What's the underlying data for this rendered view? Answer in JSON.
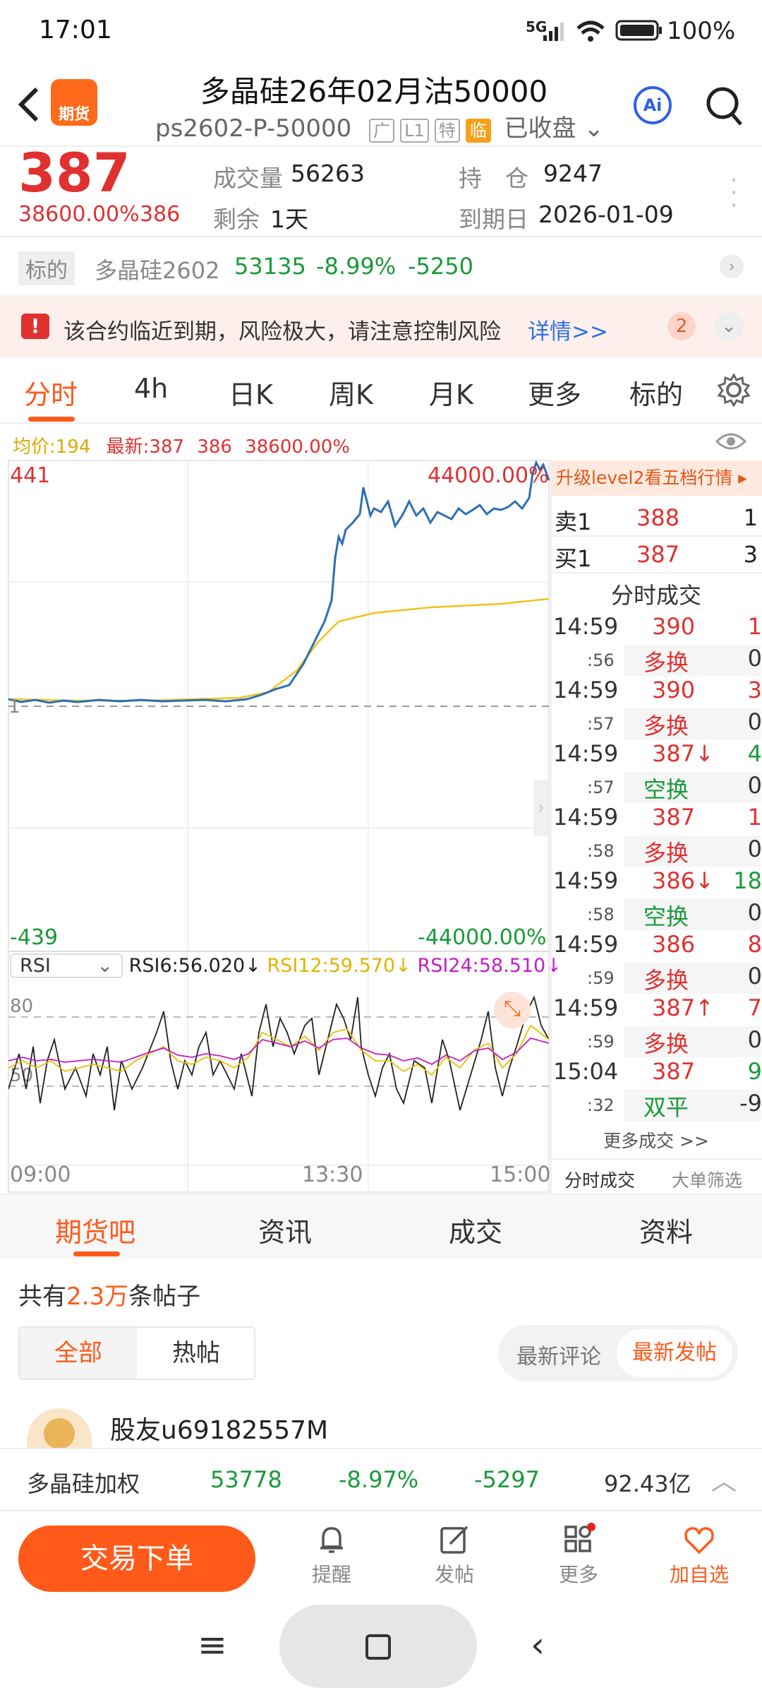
{
  "status": {
    "time": "17:01",
    "network": "5G",
    "battery": "100%"
  },
  "header": {
    "title": "多晶硅26年02月沽50000",
    "code": "ps2602-P-50000",
    "tags": [
      "广",
      "L1",
      "特",
      "临"
    ],
    "state": "已收盘",
    "app_badge": "期货",
    "ai_label": "Ai"
  },
  "quote": {
    "price": "387",
    "pct": "38600.00%",
    "change": "386",
    "vol_label": "成交量",
    "vol": "56263",
    "oi_label": "持　仓",
    "oi": "9247",
    "left_label": "剩余",
    "left": "1天",
    "exp_label": "到期日",
    "exp": "2026-01-09"
  },
  "underlying": {
    "label": "标的",
    "name": "多晶硅2602",
    "price": "53135",
    "pct": "-8.99%",
    "change": "-5250"
  },
  "warning": {
    "text": "该合约临近到期，风险极大，请注意控制风险",
    "link": "详情>>",
    "count": "2"
  },
  "tabs": [
    "分时",
    "4h",
    "日K",
    "周K",
    "月K",
    "更多",
    "标的"
  ],
  "chart_info": {
    "avg": "均价:194",
    "latest": "最新:387",
    "change": "386",
    "pct": "38600.00%"
  },
  "chart_labels": {
    "ymax": "441",
    "ymax_pct": "44000.00%",
    "ymid": "1",
    "ymin": "-439",
    "ymin_pct": "-44000.00%",
    "x": [
      "09:00",
      "13:30",
      "15:00"
    ]
  },
  "rsi": {
    "select": "RSI",
    "v6": "RSI6:56.020↓",
    "v12": "RSI12:59.570↓",
    "v24": "RSI24:58.510↓",
    "y80": "80",
    "y50": "50"
  },
  "orderbook": {
    "promo": "升级level2看五档行情 ▸",
    "sell_label": "卖1",
    "sell_price": "388",
    "sell_qty": "1",
    "buy_label": "买1",
    "buy_price": "387",
    "buy_qty": "3",
    "title": "分时成交"
  },
  "trades": [
    {
      "t": "14:59",
      "s": ":56",
      "p": "390",
      "q": "1",
      "type": "多换",
      "d": "0",
      "pc": "red",
      "tc": "red",
      "qc": "red"
    },
    {
      "t": "14:59",
      "s": ":57",
      "p": "390",
      "q": "3",
      "type": "多换",
      "d": "0",
      "pc": "red",
      "tc": "red",
      "qc": "red"
    },
    {
      "t": "14:59",
      "s": ":57",
      "p": "387↓",
      "q": "4",
      "type": "空换",
      "d": "0",
      "pc": "red",
      "tc": "green",
      "qc": "green"
    },
    {
      "t": "14:59",
      "s": ":58",
      "p": "387",
      "q": "1",
      "type": "多换",
      "d": "0",
      "pc": "red",
      "tc": "red",
      "qc": "red"
    },
    {
      "t": "14:59",
      "s": ":58",
      "p": "386↓",
      "q": "18",
      "type": "空换",
      "d": "0",
      "pc": "red",
      "tc": "green",
      "qc": "green"
    },
    {
      "t": "14:59",
      "s": ":59",
      "p": "386",
      "q": "8",
      "type": "多换",
      "d": "0",
      "pc": "red",
      "tc": "red",
      "qc": "red"
    },
    {
      "t": "14:59",
      "s": ":59",
      "p": "387↑",
      "q": "7",
      "type": "多换",
      "d": "0",
      "pc": "red",
      "tc": "red",
      "qc": "red"
    },
    {
      "t": "15:04",
      "s": ":32",
      "p": "387",
      "q": "9",
      "type": "双平",
      "d": "-9",
      "pc": "red",
      "tc": "green",
      "qc": "green"
    }
  ],
  "more_trades": "更多成交 >>",
  "bottom_tabs_small": [
    "分时成交",
    "大单筛选"
  ],
  "section_tabs": [
    "期货吧",
    "资讯",
    "成交",
    "资料"
  ],
  "posts": {
    "prefix": "共有",
    "count": "2.3万",
    "suffix": "条帖子",
    "filter": [
      "全部",
      "热帖"
    ],
    "sort": [
      "最新评论",
      "最新发帖"
    ],
    "user": "股友u69182557M"
  },
  "weighted": {
    "name": "多晶硅加权",
    "price": "53778",
    "pct": "-8.97%",
    "change": "-5297",
    "amount": "92.43亿"
  },
  "bottom_bar": {
    "trade": "交易下单",
    "items": [
      "提醒",
      "发帖",
      "更多",
      "加自选"
    ]
  }
}
